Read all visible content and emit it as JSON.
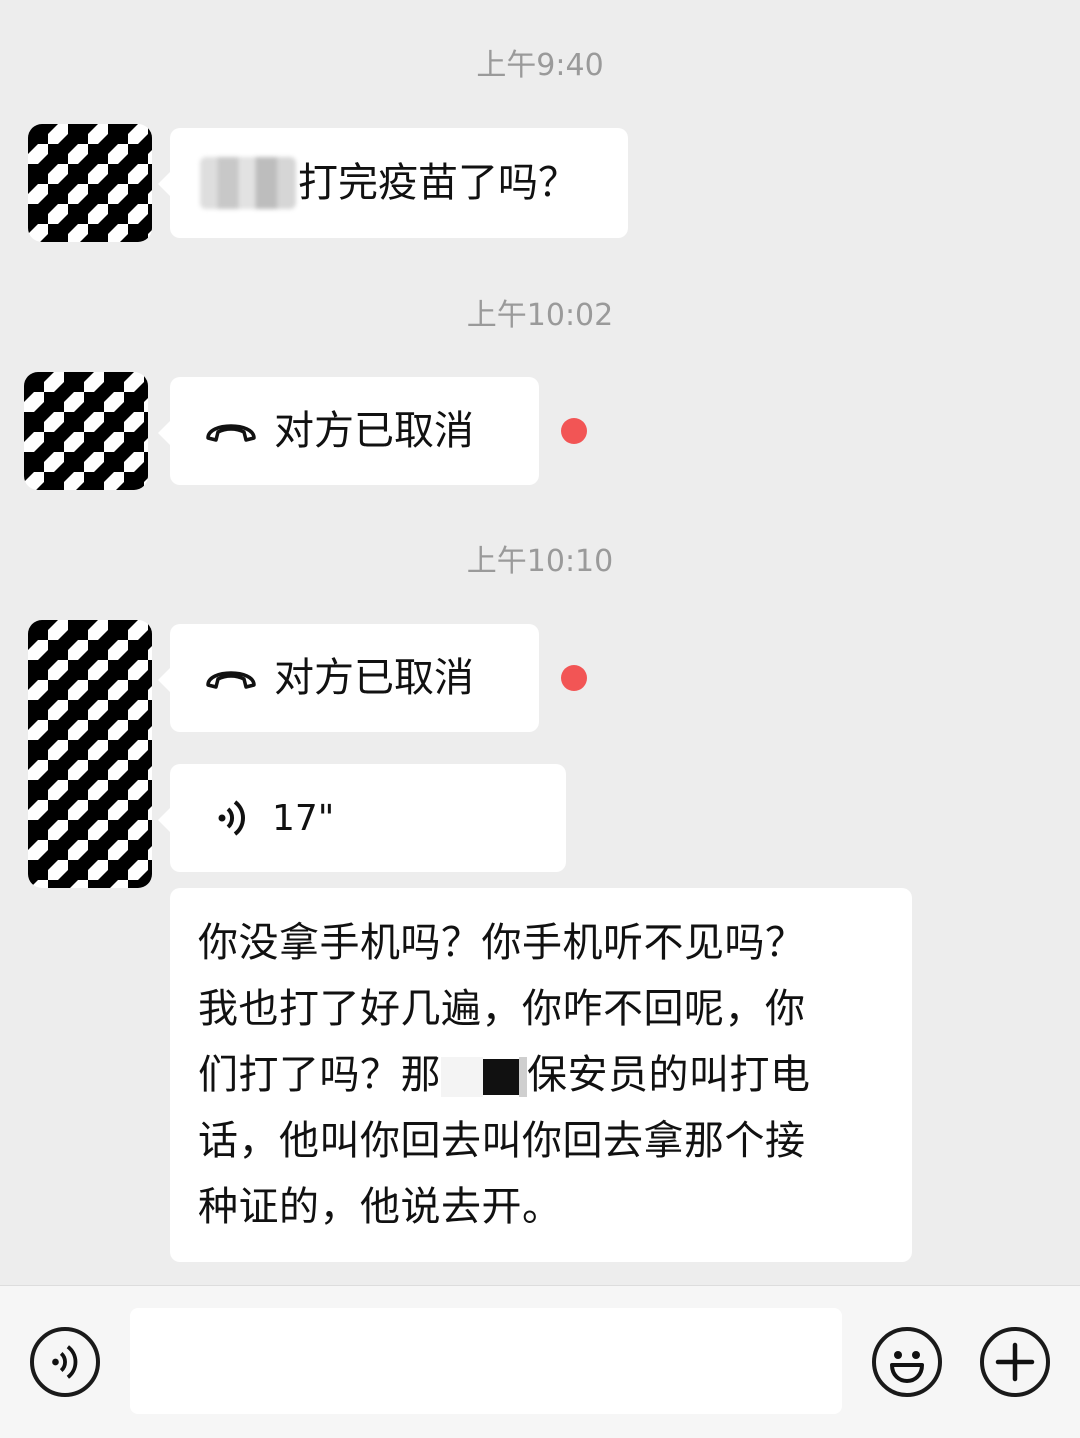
{
  "messages": [
    {
      "time": "上午9:40",
      "text": "打完疫苗了吗？"
    },
    {
      "time": "上午10:02",
      "call_text": "对方已取消"
    },
    {
      "time": "上午10:10",
      "call_text": "对方已取消",
      "voice_duration": "17\"",
      "lines": [
        "你没拿手机吗？你手机听不见吗？",
        "我也打了好几遍，你咋不回呢，你",
        "们打了吗？那",
        "保安员的叫打电",
        "话，他叫你回去叫你回去拿那个接",
        "种证的，他说去开。"
      ]
    }
  ],
  "input": {
    "placeholder": ""
  },
  "icons": {
    "voice_toggle": "voice-icon",
    "emoji": "smiley-icon",
    "more": "plus-icon",
    "call": "phone-hangup-icon",
    "voice_message": "sound-wave-icon"
  },
  "colors": {
    "background": "#ededed",
    "bubble": "#ffffff",
    "unread_dot": "#f25555",
    "timestamp": "#9a9a9a"
  }
}
